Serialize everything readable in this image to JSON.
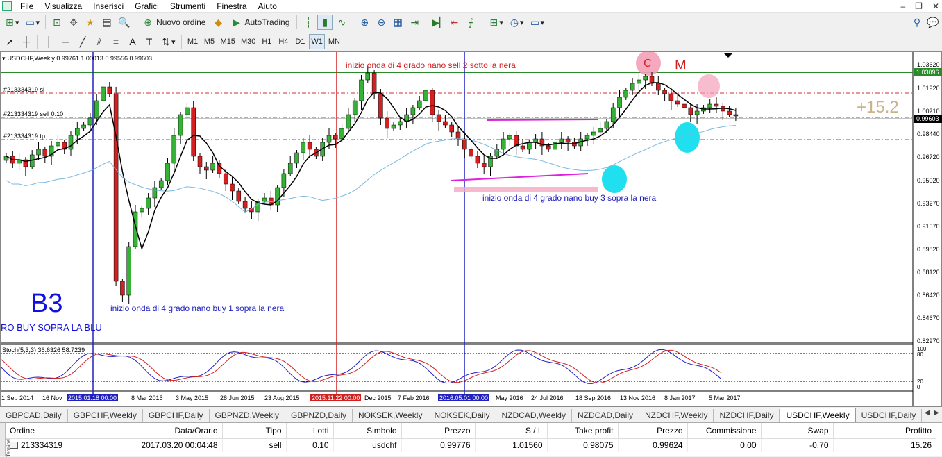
{
  "menu": [
    "File",
    "Visualizza",
    "Inserisci",
    "Grafici",
    "Strumenti",
    "Finestra",
    "Aiuto"
  ],
  "toolbar": {
    "new_order_label": "Nuovo ordine",
    "autotrading_label": "AutoTrading",
    "timeframes": [
      "M1",
      "M5",
      "M15",
      "M30",
      "H1",
      "H4",
      "D1",
      "W1",
      "MN"
    ],
    "active_timeframe": "W1"
  },
  "chart": {
    "title": "USDCHF,Weekly  0.99761 1.00013 0.99556 0.99603",
    "orders": {
      "sl": "#213334319 sl",
      "sell": "#213334319 sell 0.10",
      "tp": "#213334319 tp"
    },
    "annotations": {
      "top_red": "inizio onda di 4 grado nano sell 2 sotto la nera",
      "mid_blue": "inizio onda di 4 grado nano buy 3 sopra la nera",
      "left_blue": "inizio onda di 4 grado nano buy 1 sopra la nera",
      "b3": "B3",
      "ro_buy": "RO BUY SOPRA LA BLU",
      "c": "C",
      "m": "M",
      "profit": "+15.2"
    },
    "stoch_label": "Stoch(5,3,3) 36.6326 58.7239",
    "price_axis": [
      "1.03620",
      "1.01920",
      "1.00210",
      "0.98440",
      "0.96720",
      "0.95020",
      "0.93270",
      "0.91570",
      "0.89820",
      "0.88120",
      "0.86420",
      "0.84670",
      "0.82970"
    ],
    "price_tags": {
      "green": "1.03096",
      "current": "0.99603"
    },
    "stoch_axis": [
      "100",
      "80",
      "20",
      "0"
    ],
    "time_axis": [
      "1 Sep 2014",
      "16 Nov",
      "2015.01.18 00:00",
      "8 Mar 2015",
      "3 May 2015",
      "28 Jun 2015",
      "23 Aug 2015",
      "2015.11.22 00:00",
      "Dec 2015",
      "7 Feb 2016",
      "2016.05.01 00:00",
      "May 2016",
      "24 Jul 2016",
      "18 Sep 2016",
      "13 Nov 2016",
      "8 Jan 2017",
      "5 Mar 2017"
    ]
  },
  "tabs": [
    "GBPCAD,Daily",
    "GBPCHF,Weekly",
    "GBPCHF,Daily",
    "GBPNZD,Weekly",
    "GBPNZD,Daily",
    "NOKSEK,Weekly",
    "NOKSEK,Daily",
    "NZDCAD,Weekly",
    "NZDCAD,Daily",
    "NZDCHF,Weekly",
    "NZDCHF,Daily",
    "USDCHF,Weekly",
    "USDCHF,Daily"
  ],
  "active_tab": "USDCHF,Weekly",
  "terminal": {
    "side_label": "Terminale",
    "columns": [
      "Ordine",
      "Data/Orario",
      "Tipo",
      "Lotti",
      "Simbolo",
      "Prezzo",
      "S / L",
      "Take profit",
      "Prezzo",
      "Commissione",
      "Swap",
      "Profitto"
    ],
    "row": [
      "213334319",
      "2017.03.20 00:04:48",
      "sell",
      "0.10",
      "usdchf",
      "0.99776",
      "1.01560",
      "0.98075",
      "0.99624",
      "0.00",
      "-0.70",
      "15.26"
    ]
  }
}
